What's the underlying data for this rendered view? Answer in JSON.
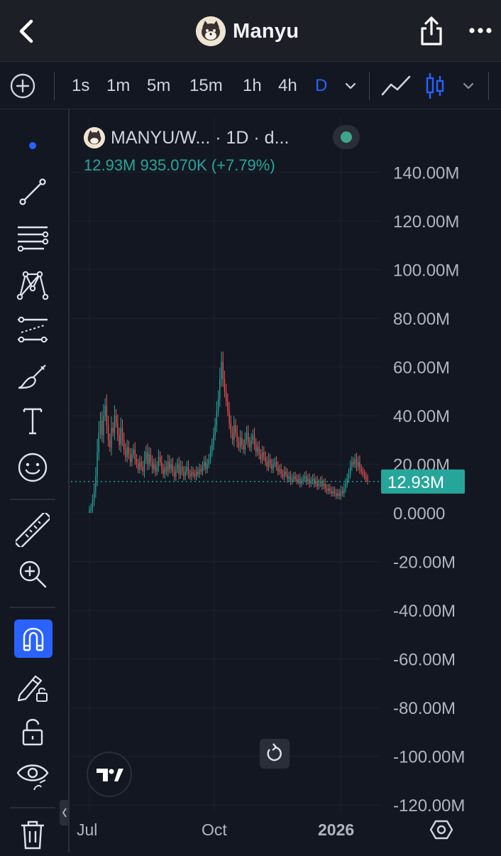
{
  "header": {
    "title": "Manyu",
    "back_icon": "chevron-left-icon",
    "share_icon": "share-icon",
    "more_icon": "more-horizontal-icon"
  },
  "toolbar": {
    "intervals": [
      "1s",
      "1m",
      "5m",
      "15m",
      "1h",
      "4h",
      "D"
    ],
    "active_interval": "D",
    "chart_style_icons": [
      "line-chart-icon",
      "candles-icon"
    ]
  },
  "left_tools": [
    "cursor-dot-icon",
    "trend-line-icon",
    "fib-lines-icon",
    "pattern-icon",
    "projection-icon",
    "brush-icon",
    "text-icon",
    "emoji-icon",
    "ruler-icon",
    "zoom-in-icon",
    "magnet-icon",
    "lock-drawing-icon",
    "unlock-icon",
    "eye-icon",
    "trash-icon"
  ],
  "legend": {
    "symbol": "MANYU/W... · 1D · d...",
    "stats": "12.93M  935.070K (+7.79%)"
  },
  "colors": {
    "up": "#26a69a",
    "down": "#ef5350",
    "accent": "#2962ff",
    "price_label": "#26a69a"
  },
  "chart_data": {
    "type": "candlestick",
    "x_tick_labels": [
      "Jul",
      "Oct",
      "2026"
    ],
    "y_tick_labels": [
      "140.00M",
      "120.00M",
      "100.00M",
      "80.00M",
      "60.00M",
      "40.00M",
      "20.00M",
      "0.0000",
      "-20.00M",
      "-40.00M",
      "-60.00M",
      "-80.00M",
      "-100.00M",
      "-120.00M"
    ],
    "ylim": [
      -122,
      146
    ],
    "y_unit": "M",
    "last_price_label": "12.93M",
    "last_value": 12.93,
    "closes": [
      1,
      2,
      5,
      9,
      15,
      25,
      33,
      38,
      32,
      40,
      44,
      36,
      30,
      27,
      35,
      33,
      40,
      37,
      32,
      28,
      35,
      30,
      26,
      23,
      27,
      24,
      21,
      24,
      26,
      22,
      20,
      18,
      21,
      19,
      17,
      22,
      25,
      20,
      24,
      21,
      18,
      20,
      17,
      19,
      23,
      21,
      18,
      16,
      19,
      17,
      21,
      18,
      20,
      17,
      15,
      18,
      20,
      16,
      19,
      17,
      15,
      17,
      19,
      16,
      15,
      17,
      16,
      15,
      17,
      16,
      18,
      17,
      19,
      21,
      18,
      20,
      22,
      25,
      28,
      32,
      36,
      42,
      47,
      55,
      62,
      55,
      50,
      46,
      42,
      37,
      33,
      30,
      36,
      33,
      29,
      27,
      31,
      28,
      26,
      30,
      33,
      29,
      27,
      30,
      32,
      28,
      25,
      27,
      24,
      22,
      25,
      23,
      21,
      19,
      22,
      20,
      18,
      20,
      21,
      19,
      17,
      18,
      16,
      15,
      17,
      16,
      14,
      15,
      13,
      14,
      15,
      14,
      13,
      14,
      12,
      13,
      14,
      15,
      13,
      14,
      12,
      13,
      14,
      12,
      13,
      11,
      12,
      13,
      11,
      12,
      10,
      9,
      10,
      9,
      8,
      9,
      8,
      7,
      8,
      7,
      9,
      8,
      10,
      12,
      14,
      16,
      19,
      21,
      20,
      22,
      19,
      21,
      18,
      17,
      16,
      15,
      14,
      13
    ],
    "grid": true
  }
}
